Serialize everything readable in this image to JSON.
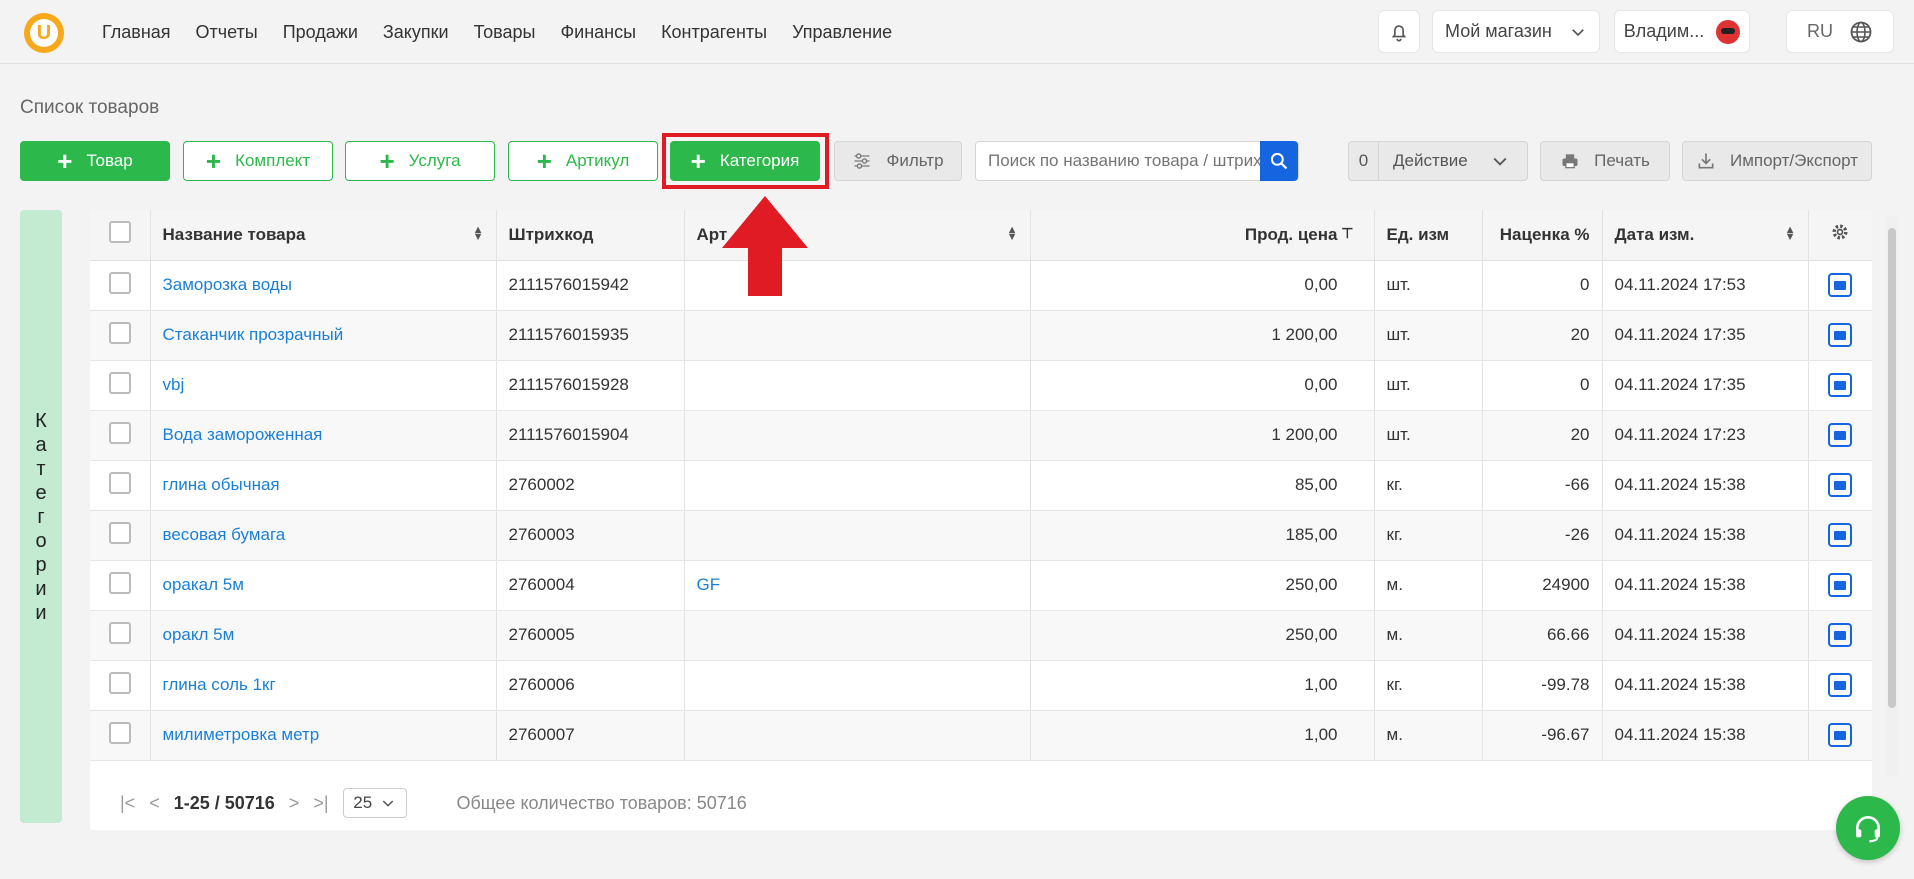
{
  "header": {
    "nav": [
      "Главная",
      "Отчеты",
      "Продажи",
      "Закупки",
      "Товары",
      "Финансы",
      "Контрагенты",
      "Управление"
    ],
    "store_label": "Мой магазин",
    "user_label": "Владим...",
    "lang_label": "RU"
  },
  "page": {
    "title": "Список товаров"
  },
  "toolbar": {
    "product_btn": "Товар",
    "kit_btn": "Комплект",
    "service_btn": "Услуга",
    "article_btn": "Артикул",
    "category_btn": "Категория",
    "filter_btn": "Фильтр",
    "search_placeholder": "Поиск по названию товара / штрихкоду",
    "action_count": "0",
    "action_btn": "Действие",
    "print_btn": "Печать",
    "import_btn": "Импорт/Экспорт"
  },
  "sidebar": {
    "categories_label": [
      "К",
      "а",
      "т",
      "е",
      "г",
      "о",
      "р",
      "и",
      "и"
    ]
  },
  "table": {
    "columns": {
      "name": "Название товара",
      "barcode": "Штрихкод",
      "article": "Арт",
      "price": "Прод. цена",
      "unit": "Ед. изм",
      "markup": "Наценка %",
      "date": "Дата изм."
    },
    "rows": [
      {
        "name": "Заморозка воды",
        "barcode": "2111576015942",
        "article": "",
        "price": "0,00",
        "unit": "шт.",
        "markup": "0",
        "date": "04.11.2024 17:53"
      },
      {
        "name": "Стаканчик прозрачный",
        "barcode": "2111576015935",
        "article": "",
        "price": "1 200,00",
        "unit": "шт.",
        "markup": "20",
        "date": "04.11.2024 17:35"
      },
      {
        "name": "vbj",
        "barcode": "2111576015928",
        "article": "",
        "price": "0,00",
        "unit": "шт.",
        "markup": "0",
        "date": "04.11.2024 17:35"
      },
      {
        "name": "Вода замороженная",
        "barcode": "2111576015904",
        "article": "",
        "price": "1 200,00",
        "unit": "шт.",
        "markup": "20",
        "date": "04.11.2024 17:23"
      },
      {
        "name": "глина обычная",
        "barcode": "2760002",
        "article": "",
        "price": "85,00",
        "unit": "кг.",
        "markup": "-66",
        "date": "04.11.2024 15:38"
      },
      {
        "name": "весовая бумага",
        "barcode": "2760003",
        "article": "",
        "price": "185,00",
        "unit": "кг.",
        "markup": "-26",
        "date": "04.11.2024 15:38"
      },
      {
        "name": "оракал 5м",
        "barcode": "2760004",
        "article": "GF",
        "price": "250,00",
        "unit": "м.",
        "markup": "24900",
        "date": "04.11.2024 15:38"
      },
      {
        "name": "оракл 5м",
        "barcode": "2760005",
        "article": "",
        "price": "250,00",
        "unit": "м.",
        "markup": "66.66",
        "date": "04.11.2024 15:38"
      },
      {
        "name": "глина соль 1кг",
        "barcode": "2760006",
        "article": "",
        "price": "1,00",
        "unit": "кг.",
        "markup": "-99.78",
        "date": "04.11.2024 15:38"
      },
      {
        "name": "милиметровка метр",
        "barcode": "2760007",
        "article": "",
        "price": "1,00",
        "unit": "м.",
        "markup": "-96.67",
        "date": "04.11.2024 15:38"
      }
    ]
  },
  "pager": {
    "range": "1-25 / 50716",
    "page_size": "25",
    "total": "Общее количество товаров: 50716"
  },
  "colors": {
    "accent": "#2db84b",
    "link": "#1a7fd6",
    "highlight": "#e01b24",
    "primary": "#1565e0"
  }
}
